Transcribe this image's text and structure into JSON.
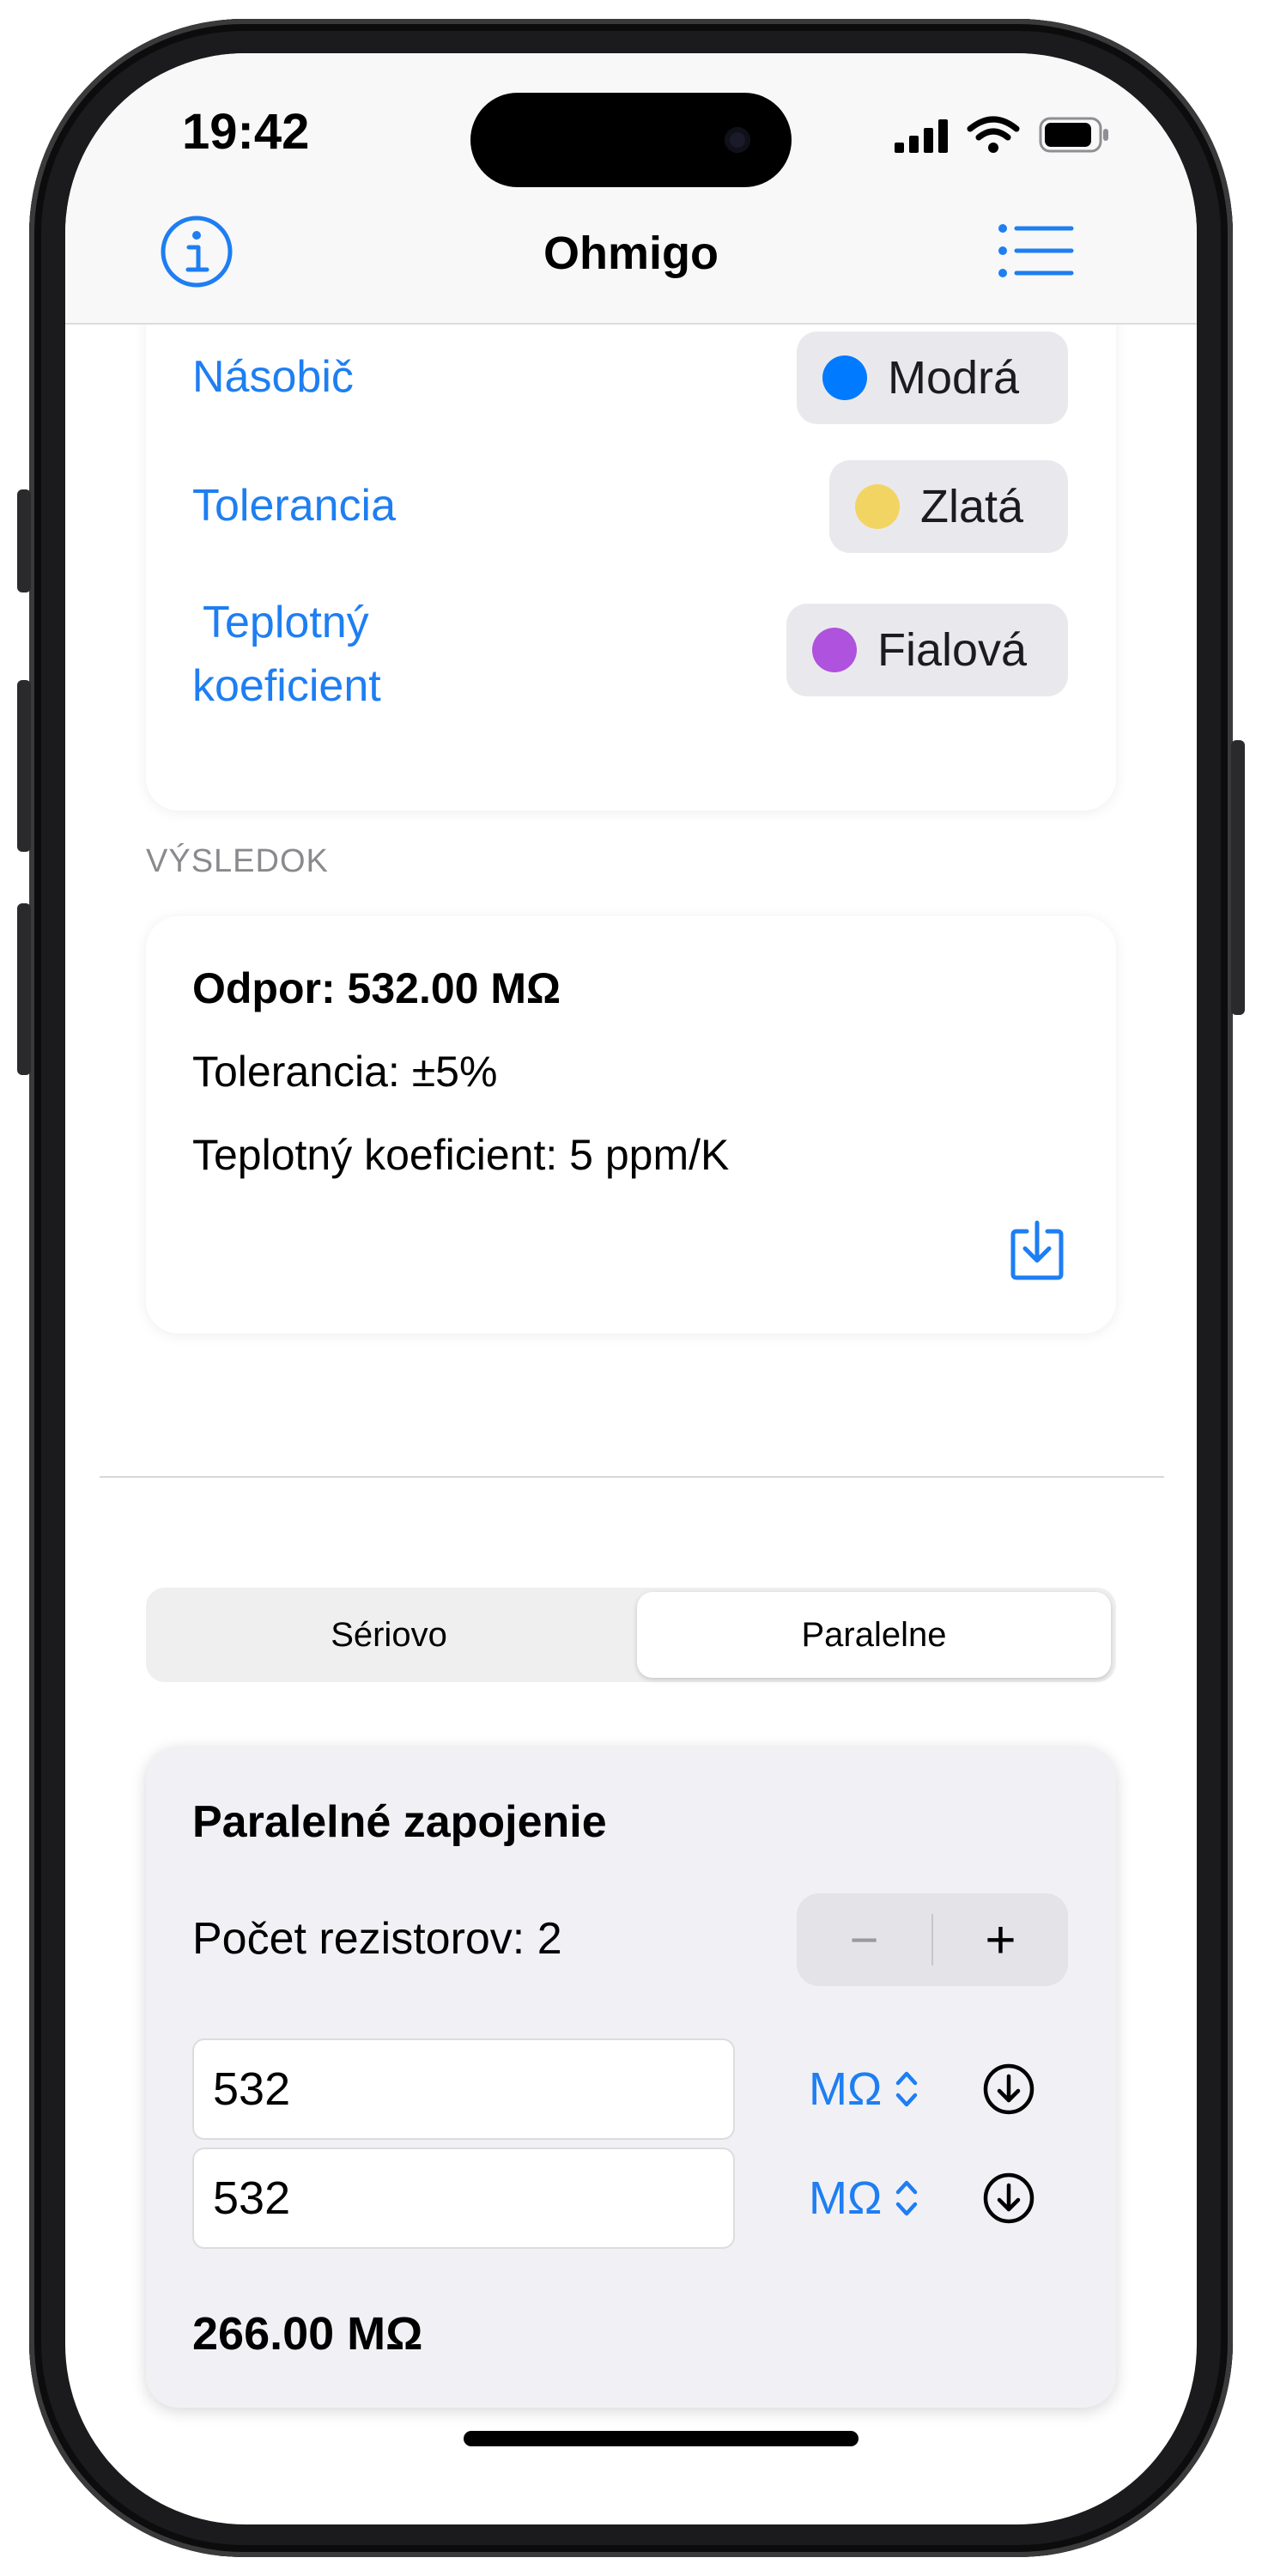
{
  "status_bar": {
    "time": "19:42"
  },
  "nav": {
    "title": "Ohmigo",
    "info_icon": "info-circle-icon",
    "menu_icon": "list-icon"
  },
  "bands": [
    {
      "label": "Násobič",
      "value": "Modrá",
      "color": "#007aff"
    },
    {
      "label": "Tolerancia",
      "value": "Zlatá",
      "color": "#f2d462"
    },
    {
      "label_line1": "Teplotný",
      "label_line2": "koeficient",
      "value": "Fialová",
      "color": "#af52de"
    }
  ],
  "result": {
    "header": "VÝSLEDOK",
    "resistance": "Odpor: 532.00 MΩ",
    "tolerance": "Tolerancia: ±5%",
    "temp_coef": "Teplotný koeficient: 5 ppm/K",
    "save_icon": "download-tray-icon"
  },
  "mode": {
    "options": [
      "Sériovo",
      "Paralelne"
    ],
    "selected": "Paralelne"
  },
  "parallel": {
    "title": "Paralelné zapojenie",
    "count_label": "Počet rezistorov: 2",
    "minus": "−",
    "plus": "+",
    "resistors": [
      {
        "value": "532",
        "unit": "MΩ"
      },
      {
        "value": "532",
        "unit": "MΩ"
      }
    ],
    "total": "266.00 MΩ"
  },
  "colors": {
    "accent": "#1e7ef2"
  }
}
